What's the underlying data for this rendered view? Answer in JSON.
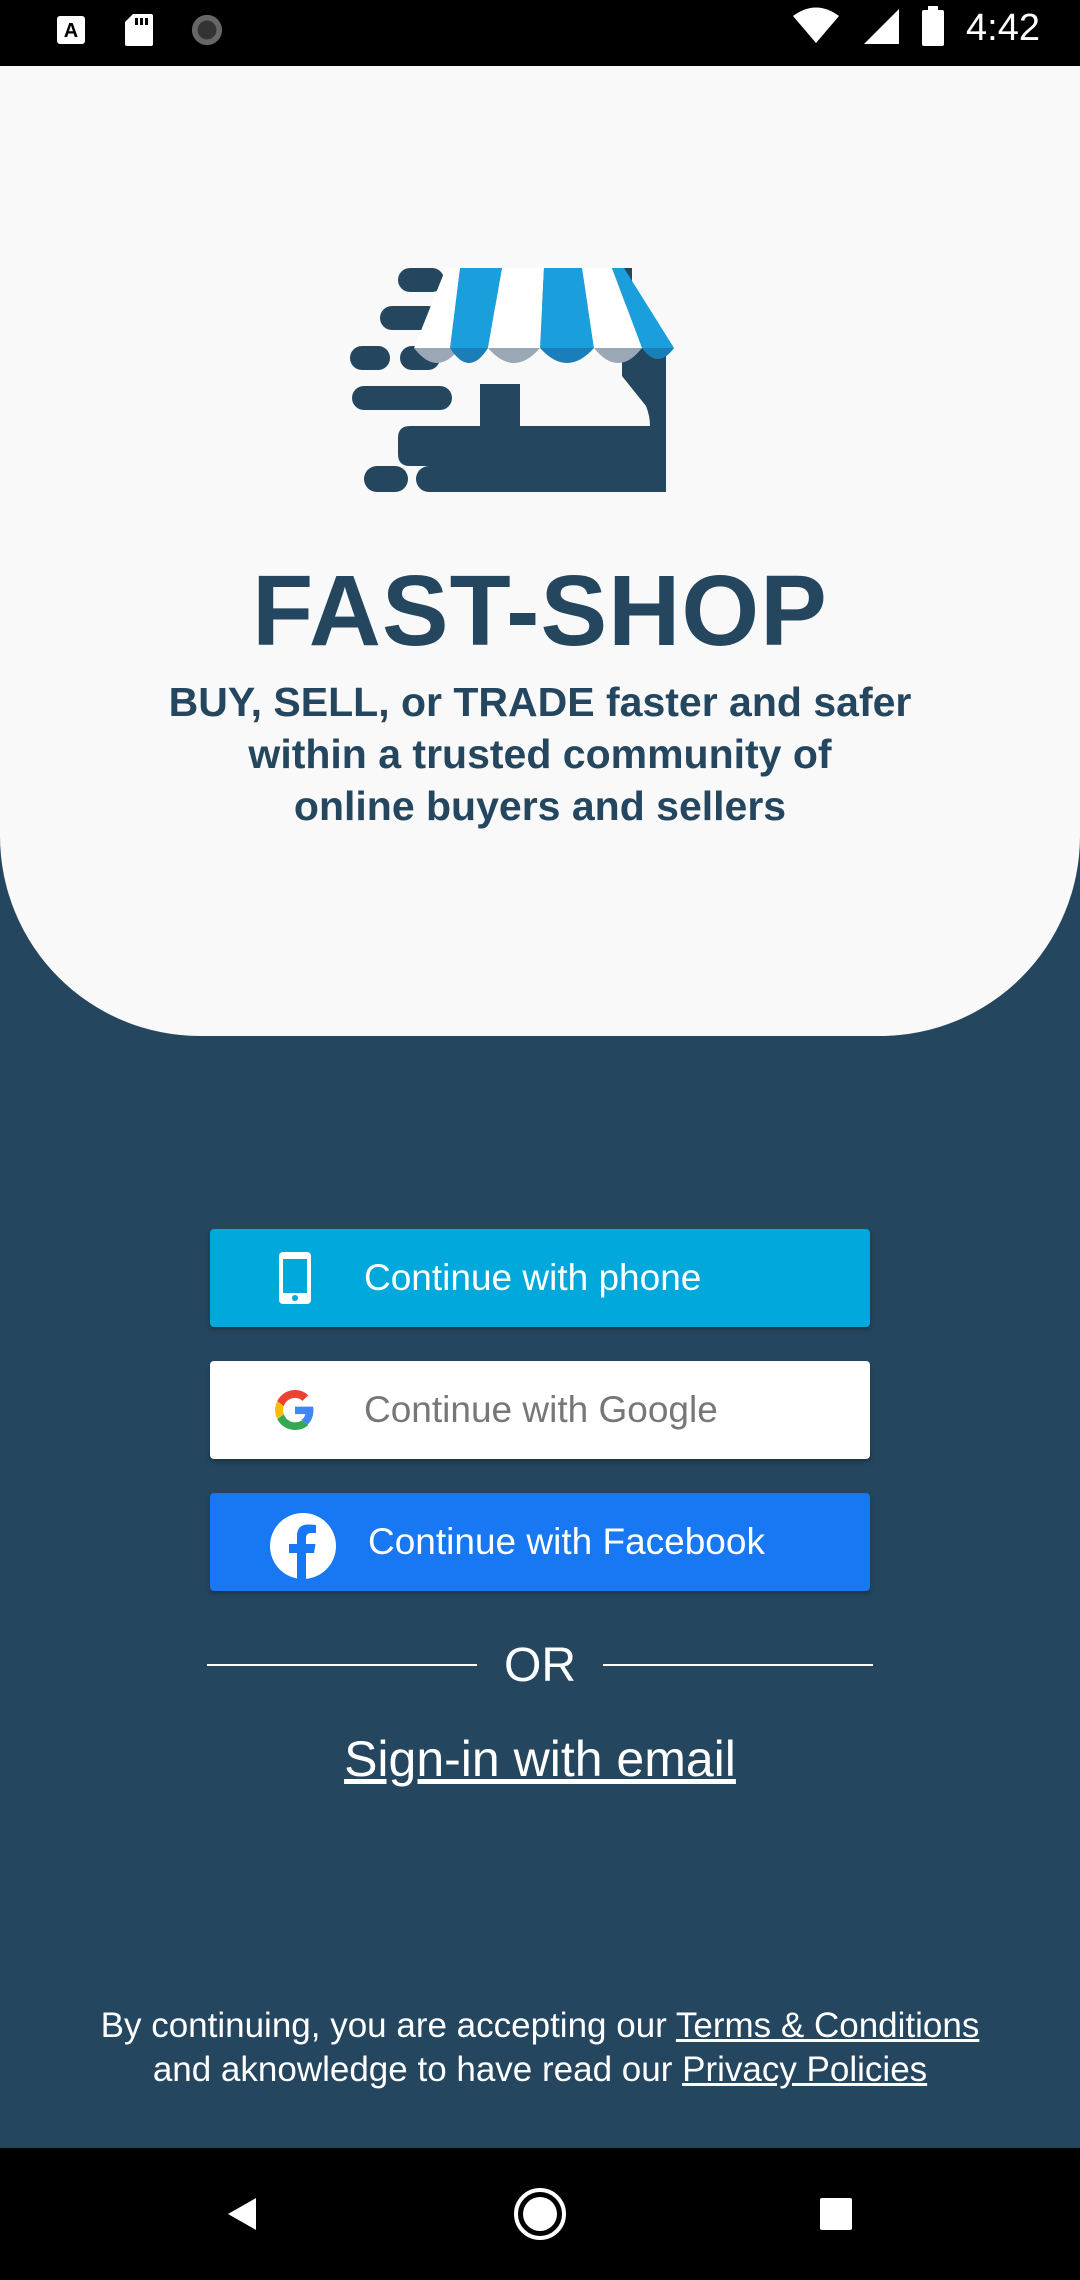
{
  "status_bar": {
    "time": "4:42",
    "icons": [
      "font-icon",
      "sd-card-icon",
      "sync-icon",
      "wifi-icon",
      "signal-icon",
      "battery-icon"
    ]
  },
  "hero": {
    "brand": "FAST-SHOP",
    "tagline": "BUY, SELL, or TRADE faster and safer\nwithin a trusted community of\nonline buyers and sellers",
    "logo_icon": "storefront-speed-icon"
  },
  "buttons": {
    "phone": {
      "label": "Continue with phone",
      "icon": "phone-icon",
      "color": "#00a8dc"
    },
    "google": {
      "label": "Continue with Google",
      "icon": "google-icon",
      "color": "#ffffff"
    },
    "facebook": {
      "label": "Continue with Facebook",
      "icon": "facebook-icon",
      "color": "#1877f2"
    }
  },
  "divider": {
    "text": "OR"
  },
  "email_link": {
    "label": "Sign-in with email"
  },
  "legal": {
    "prefix1": "By continuing, you are accepting our ",
    "terms_link": "Terms & Conditions",
    "prefix2": "and aknowledge to have read our ",
    "privacy_link": "Privacy Policies"
  },
  "colors": {
    "background": "#25465f",
    "hero": "#f9f9f9",
    "brand_text": "#25465f"
  },
  "nav": {
    "icons": [
      "back-icon",
      "home-icon",
      "recents-icon"
    ]
  }
}
